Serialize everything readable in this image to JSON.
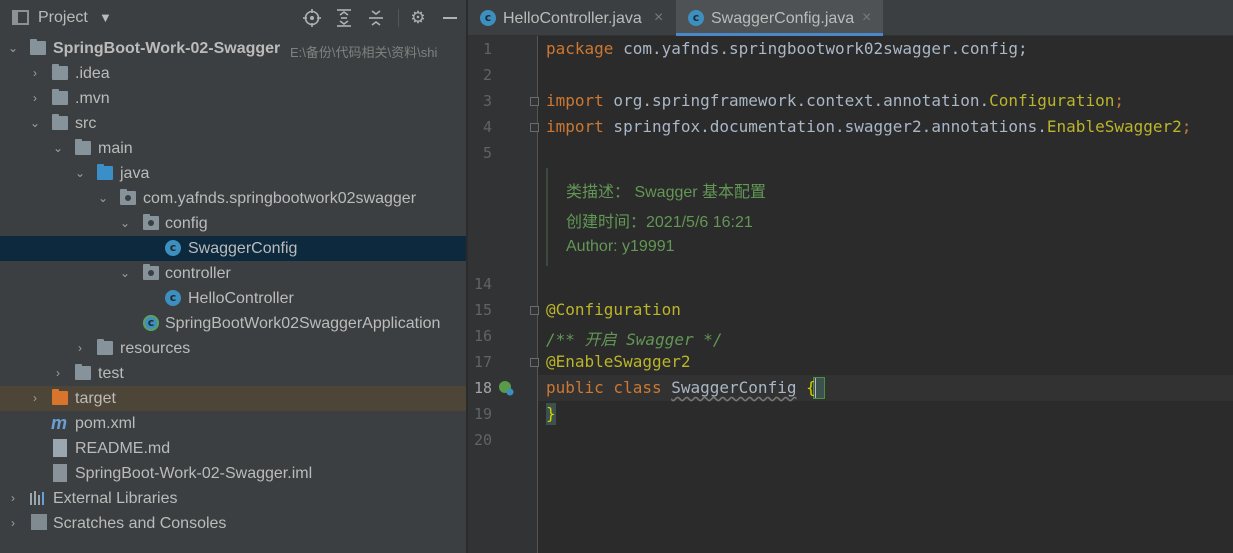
{
  "project": {
    "title": "Project",
    "tree": [
      {
        "label": "SpringBoot-Work-02-Swagger",
        "hint": "E:\\备份\\代码相关\\资料\\shi"
      },
      {
        "label": ".idea"
      },
      {
        "label": ".mvn"
      },
      {
        "label": "src"
      },
      {
        "label": "main"
      },
      {
        "label": "java"
      },
      {
        "label": "com.yafnds.springbootwork02swagger"
      },
      {
        "label": "config"
      },
      {
        "label": "SwaggerConfig"
      },
      {
        "label": "controller"
      },
      {
        "label": "HelloController"
      },
      {
        "label": "SpringBootWork02SwaggerApplication"
      },
      {
        "label": "resources"
      },
      {
        "label": "test"
      },
      {
        "label": "target"
      },
      {
        "label": "pom.xml"
      },
      {
        "label": "README.md"
      },
      {
        "label": "SpringBoot-Work-02-Swagger.iml"
      },
      {
        "label": "External Libraries"
      },
      {
        "label": "Scratches and Consoles"
      }
    ]
  },
  "editor": {
    "tabs": [
      {
        "label": "HelloController.java",
        "active": false
      },
      {
        "label": "SwaggerConfig.java",
        "active": true
      }
    ],
    "line_numbers": [
      "1",
      "2",
      "3",
      "4",
      "5",
      "14",
      "15",
      "16",
      "17",
      "18",
      "19",
      "20"
    ],
    "current_line": "18",
    "code": {
      "l1_kw": "package",
      "l1_rest": " com.yafnds.springbootwork02swagger.config;",
      "l3_kw": "import",
      "l3_rest": " org.springframework.context.annotation.",
      "l3_cls": "Configuration",
      "l3_end": ";",
      "l4_kw": "import",
      "l4_rest": " springfox.documentation.swagger2.annotations.",
      "l4_cls": "EnableSwagger2",
      "l4_end": ";",
      "doc_lines": [
        "类描述： Swagger 基本配置",
        "创建时间：2021/5/6 16:21",
        "Author: y19991"
      ],
      "l15": "@Configuration",
      "l16": "/** 开启 Swagger */",
      "l17": "@EnableSwagger2",
      "l18_kw": "public class",
      "l18_name": "SwaggerConfig",
      "l18_brace": "{",
      "l19": "}"
    }
  }
}
